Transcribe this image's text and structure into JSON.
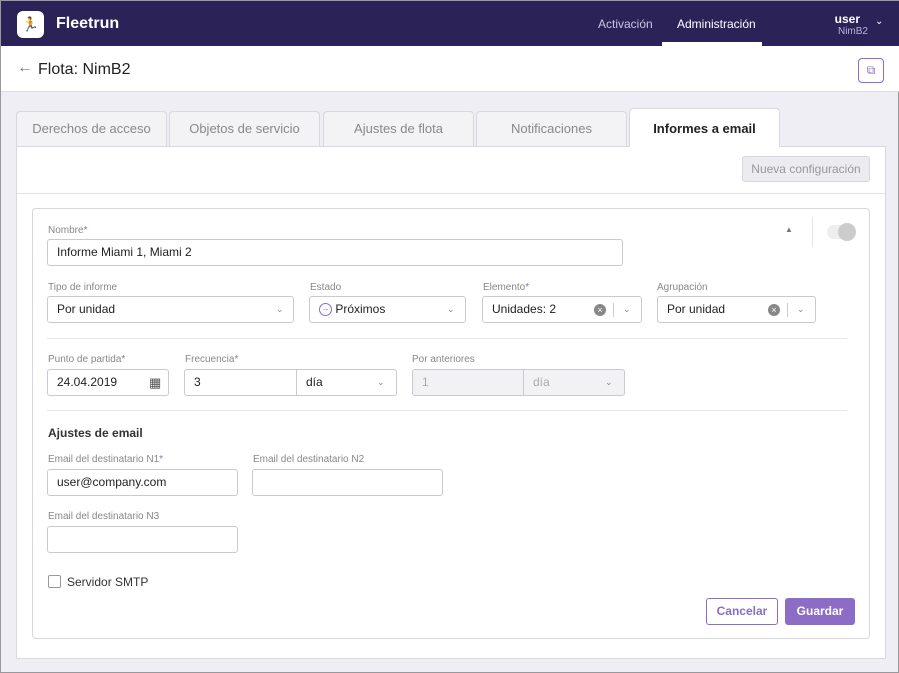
{
  "header": {
    "brand": "Fleetrun",
    "nav": [
      "Activación",
      "Administración"
    ],
    "user": "user",
    "org": "NimB2"
  },
  "page": {
    "title": "Flota: NimB2"
  },
  "tabs": [
    "Derechos de acceso",
    "Objetos de servicio",
    "Ajustes de flota",
    "Notificaciones",
    "Informes a email"
  ],
  "toolbar": {
    "new_config": "Nueva configuración"
  },
  "form": {
    "name_label": "Nombre",
    "name_value": "Informe Miami 1, Miami 2",
    "type_label": "Tipo de informe",
    "type_value": "Por unidad",
    "state_label": "Estado",
    "state_value": "Próximos",
    "element_label": "Elemento",
    "element_value": "Unidades: 2",
    "group_label": "Agrupación",
    "group_value": "Por unidad",
    "start_label": "Punto de partida",
    "start_value": "24.04.2019",
    "freq_label": "Frecuencia",
    "freq_value": "3",
    "freq_unit": "día",
    "prev_label": "Por anteriores",
    "prev_value": "1",
    "prev_unit": "día",
    "email_section": "Ajustes de email",
    "email1_label": "Email  del destinatario N1",
    "email1_value": "user@company.com",
    "email2_label": "Email  del destinatario N2",
    "email2_value": "",
    "email3_label": "Email  del destinatario N3",
    "email3_value": "",
    "smtp_label": "Servidor SMTP",
    "req": "*",
    "cancel": "Cancelar",
    "save": "Guardar"
  },
  "colors": {
    "header": "#2b2358",
    "accent": "#8c6cc4"
  }
}
